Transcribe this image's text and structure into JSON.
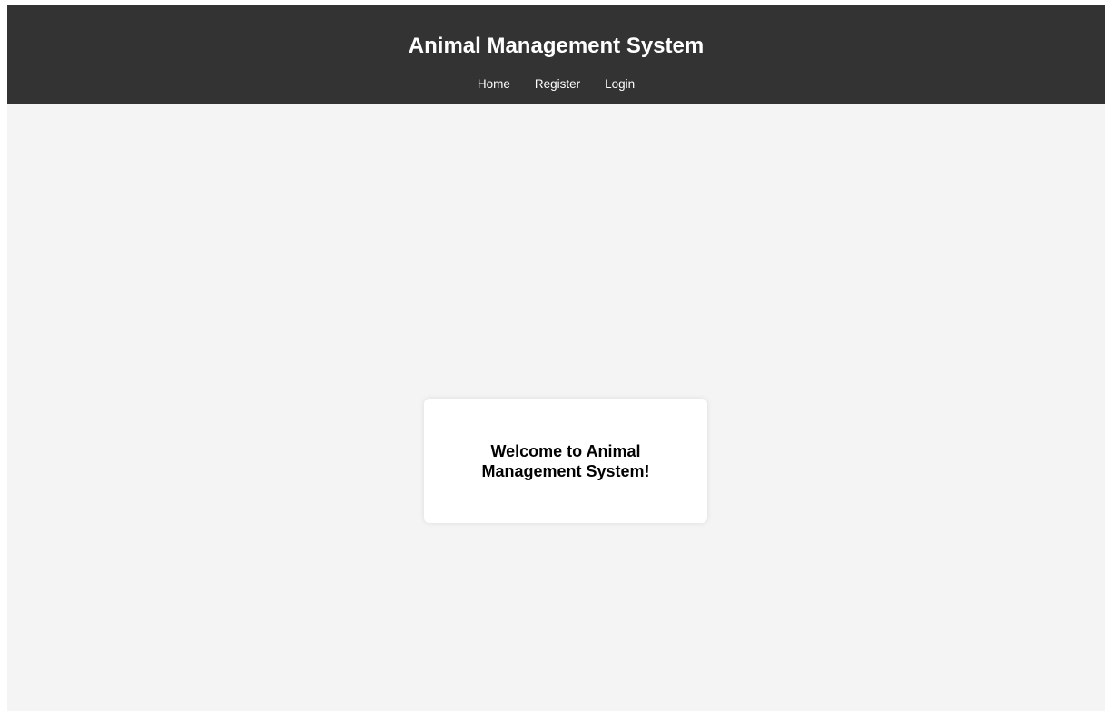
{
  "header": {
    "title": "Animal Management System",
    "nav": {
      "home": "Home",
      "register": "Register",
      "login": "Login"
    }
  },
  "main": {
    "welcome": "Welcome to Animal Management System!"
  },
  "colors": {
    "header_bg": "#333333",
    "page_bg": "#f4f4f4",
    "card_bg": "#ffffff"
  }
}
